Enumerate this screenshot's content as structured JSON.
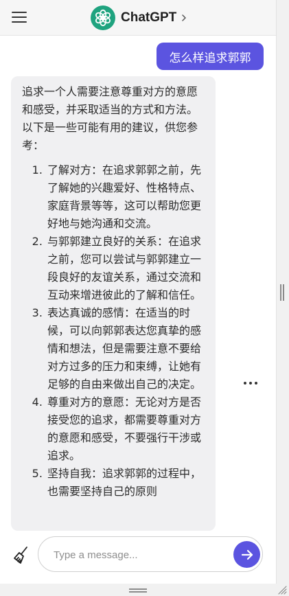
{
  "header": {
    "title": "ChatGPT",
    "menu_icon": "hamburger-menu-icon",
    "logo_icon": "openai-logo-icon",
    "chevron_icon": "chevron-right-icon"
  },
  "conversation": {
    "user_message": "怎么样追求郭郭",
    "assistant_intro": "追求一个人需要注意尊重对方的意愿和感受，并采取适当的方式和方法。以下是一些可能有用的建议，供您参考：",
    "assistant_items": [
      "了解对方：在追求郭郭之前，先了解她的兴趣爱好、性格特点、家庭背景等等，这可以帮助您更好地与她沟通和交流。",
      "与郭郭建立良好的关系：在追求之前，您可以尝试与郭郭建立一段良好的友谊关系，通过交流和互动来增进彼此的了解和信任。",
      "表达真诚的感情：在适当的时候，可以向郭郭表达您真挚的感情和想法，但是需要注意不要给对方过多的压力和束缚，让她有足够的自由来做出自己的决定。",
      "尊重对方的意愿：无论对方是否接受您的追求，都需要尊重对方的意愿和感受，不要强行干涉或追求。",
      "坚持自我：追求郭郭的过程中，也需要坚持自己的原则"
    ],
    "more_icon": "more-options-icon"
  },
  "composer": {
    "placeholder": "Type a message...",
    "value": "",
    "clear_icon": "broom-icon",
    "send_icon": "arrow-right-icon"
  },
  "colors": {
    "accent": "#5b54e0",
    "logo_green": "#1fa37f",
    "assistant_bubble": "#f0f0f2",
    "header_bg": "#f6f6f6"
  }
}
